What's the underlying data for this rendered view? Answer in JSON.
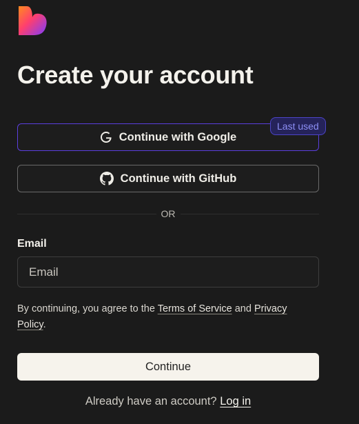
{
  "logo": {
    "icon": "heart-logo-icon"
  },
  "heading": {
    "title": "Create your account"
  },
  "oauth": {
    "google_label": "Continue with Google",
    "google_icon": "google-icon",
    "github_label": "Continue with GitHub",
    "github_icon": "github-icon",
    "last_used_badge": "Last used"
  },
  "divider": {
    "text": "OR"
  },
  "email": {
    "label": "Email",
    "placeholder": "Email",
    "value": ""
  },
  "terms": {
    "prefix": "By continuing, you agree to the",
    "tos_link": "Terms of Service",
    "and": "and",
    "privacy_link": "Privacy Policy",
    "suffix": "."
  },
  "actions": {
    "continue_label": "Continue"
  },
  "login": {
    "prompt": "Already have an account?",
    "link": "Log in"
  },
  "colors": {
    "background": "#1b1b1b",
    "accent_border": "#5b3fe0",
    "badge_bg": "#25235a",
    "badge_text": "#8d8ff5",
    "primary_button": "#f6f3ec"
  }
}
